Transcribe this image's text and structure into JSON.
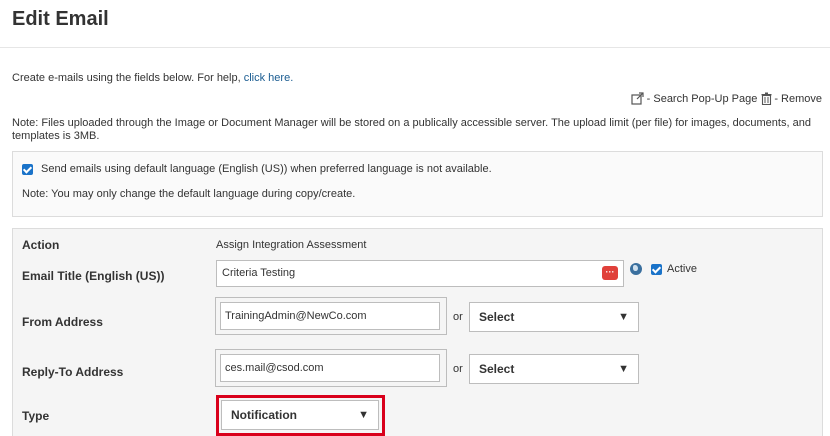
{
  "page": {
    "title": "Edit Email",
    "intro_text": "Create e-mails using the fields below. For help,",
    "help_link": "click here."
  },
  "toolbar": {
    "search_popup": "- Search Pop-Up Page",
    "remove": "- Remove"
  },
  "note_upload": "Note: Files uploaded through the Image or Document Manager will be stored on a publically accessible server. The upload limit (per file) for images, documents, and templates is 3MB.",
  "language": {
    "checkbox_label": "Send emails using default language (English (US)) when preferred language is not available.",
    "checked": true,
    "note": "Note: You may only change the default language during copy/create."
  },
  "form": {
    "action_label": "Action",
    "action_value": "Assign Integration Assessment",
    "email_title_label": "Email Title (English (US))",
    "email_title_value": "Criteria Testing",
    "active_label": "Active",
    "active_checked": true,
    "from_label": "From Address",
    "from_value": "TrainingAdmin@NewCo.com",
    "from_select": "Select",
    "reply_label": "Reply-To Address",
    "reply_value": "ces.mail@csod.com",
    "reply_select": "Select",
    "or_text": "or",
    "type_label": "Type",
    "type_value": "Notification"
  },
  "icons": {
    "dropdown_arrow": "▼",
    "lang_button": "···"
  },
  "colors": {
    "link": "#1a5c91",
    "checkbox": "#1a73c9",
    "highlight": "#d9001b",
    "lang_button": "#e0403a"
  }
}
